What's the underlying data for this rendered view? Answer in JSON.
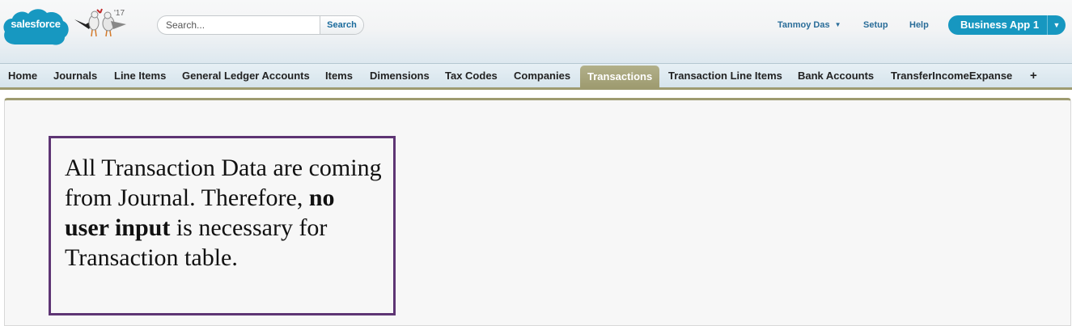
{
  "header": {
    "logo_text": "salesforce",
    "mascot_badge": "'17",
    "search": {
      "placeholder": "Search...",
      "button_label": "Search"
    },
    "user_name": "Tanmoy Das",
    "setup_label": "Setup",
    "help_label": "Help",
    "app_switcher_label": "Business App 1",
    "colors": {
      "brand": "#1797c0",
      "link": "#2a6d99"
    }
  },
  "tabs": [
    {
      "label": "Home"
    },
    {
      "label": "Journals"
    },
    {
      "label": "Line Items"
    },
    {
      "label": "General Ledger Accounts"
    },
    {
      "label": "Items"
    },
    {
      "label": "Dimensions"
    },
    {
      "label": "Tax Codes"
    },
    {
      "label": "Companies"
    },
    {
      "label": "Transactions",
      "active": true
    },
    {
      "label": "Transaction Line Items"
    },
    {
      "label": "Bank Accounts"
    },
    {
      "label": "TransferIncomeExpanse"
    }
  ],
  "add_tab_icon": "+",
  "note": {
    "text_before": "All Transaction Data are coming from Journal. Therefore, ",
    "text_bold": "no user input",
    "text_after": " is necessary for Transaction table.",
    "border_color": "#5e3574"
  }
}
